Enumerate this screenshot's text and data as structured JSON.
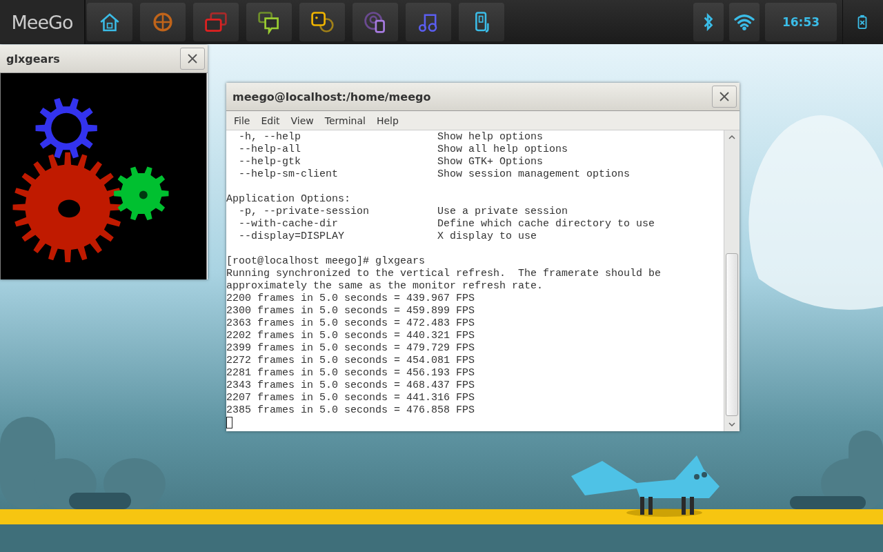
{
  "taskbar": {
    "logo": "MeeGo",
    "apps": [
      {
        "kind": "home"
      },
      {
        "kind": "quadrants"
      },
      {
        "kind": "windows"
      },
      {
        "kind": "chat"
      },
      {
        "kind": "people"
      },
      {
        "kind": "media"
      },
      {
        "kind": "music"
      },
      {
        "kind": "device"
      }
    ],
    "clock": "16:53"
  },
  "glxgears_window": {
    "title": "glxgears"
  },
  "terminal_window": {
    "title": "meego@localhost:/home/meego",
    "menu": [
      "File",
      "Edit",
      "View",
      "Terminal",
      "Help"
    ],
    "lines": [
      {
        "kind": "option",
        "option": "-h, --help",
        "description": "Show help options"
      },
      {
        "kind": "option",
        "option": "--help-all",
        "description": "Show all help options"
      },
      {
        "kind": "option",
        "option": "--help-gtk",
        "description": "Show GTK+ Options"
      },
      {
        "kind": "option",
        "option": "--help-sm-client",
        "description": "Show session management options"
      },
      {
        "kind": "blank"
      },
      {
        "kind": "text",
        "text": "Application Options:"
      },
      {
        "kind": "option",
        "option": "-p, --private-session",
        "description": "Use a private session"
      },
      {
        "kind": "option",
        "option": "--with-cache-dir",
        "description": "Define which cache directory to use"
      },
      {
        "kind": "option",
        "option": "--display=DISPLAY",
        "description": "X display to use"
      },
      {
        "kind": "blank"
      },
      {
        "kind": "text",
        "text": "[root@localhost meego]# glxgears"
      },
      {
        "kind": "text",
        "text": "Running synchronized to the vertical refresh.  The framerate should be"
      },
      {
        "kind": "text",
        "text": "approximately the same as the monitor refresh rate."
      },
      {
        "kind": "text",
        "text": "2200 frames in 5.0 seconds = 439.967 FPS"
      },
      {
        "kind": "text",
        "text": "2300 frames in 5.0 seconds = 459.899 FPS"
      },
      {
        "kind": "text",
        "text": "2363 frames in 5.0 seconds = 472.483 FPS"
      },
      {
        "kind": "text",
        "text": "2202 frames in 5.0 seconds = 440.321 FPS"
      },
      {
        "kind": "text",
        "text": "2399 frames in 5.0 seconds = 479.729 FPS"
      },
      {
        "kind": "text",
        "text": "2272 frames in 5.0 seconds = 454.081 FPS"
      },
      {
        "kind": "text",
        "text": "2281 frames in 5.0 seconds = 456.193 FPS"
      },
      {
        "kind": "text",
        "text": "2343 frames in 5.0 seconds = 468.437 FPS"
      },
      {
        "kind": "text",
        "text": "2207 frames in 5.0 seconds = 441.316 FPS"
      },
      {
        "kind": "text",
        "text": "2385 frames in 5.0 seconds = 476.858 FPS"
      },
      {
        "kind": "cursor"
      }
    ]
  }
}
